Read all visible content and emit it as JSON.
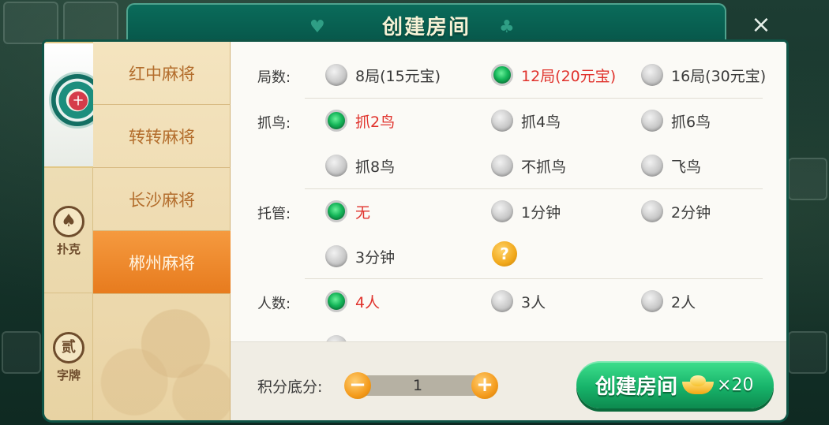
{
  "header": {
    "title": "创建房间",
    "close_icon": "×"
  },
  "categories": [
    {
      "name": "mahjong",
      "label": ""
    },
    {
      "name": "poker",
      "icon": "♠",
      "label": "扑克"
    },
    {
      "name": "word-tiles",
      "icon": "贰",
      "label": "字牌"
    }
  ],
  "mahjong_emblem_text": "十",
  "sub_tabs": [
    {
      "label": "红中麻将",
      "active": false
    },
    {
      "label": "转转麻将",
      "active": false
    },
    {
      "label": "长沙麻将",
      "active": false
    },
    {
      "label": "郴州麻将",
      "active": true
    }
  ],
  "rounds": {
    "label": "局数:",
    "options": [
      {
        "label": "8局(15元宝)",
        "selected": false
      },
      {
        "label": "12局(20元宝)",
        "selected": true
      },
      {
        "label": "16局(30元宝)",
        "selected": false
      }
    ]
  },
  "birds": {
    "label": "抓鸟:",
    "options": [
      {
        "label": "抓2鸟",
        "selected": true
      },
      {
        "label": "抓4鸟",
        "selected": false
      },
      {
        "label": "抓6鸟",
        "selected": false
      },
      {
        "label": "抓8鸟",
        "selected": false
      },
      {
        "label": "不抓鸟",
        "selected": false
      },
      {
        "label": "飞鸟",
        "selected": false
      }
    ]
  },
  "hosting": {
    "label": "托管:",
    "options": [
      {
        "label": "无",
        "selected": true
      },
      {
        "label": "1分钟",
        "selected": false
      },
      {
        "label": "2分钟",
        "selected": false
      },
      {
        "label": "3分钟",
        "selected": false
      }
    ],
    "help_icon": "?"
  },
  "players": {
    "label": "人数:",
    "options": [
      {
        "label": "4人",
        "selected": true
      },
      {
        "label": "3人",
        "selected": false
      },
      {
        "label": "2人",
        "selected": false
      }
    ]
  },
  "score": {
    "label": "积分底分:",
    "value": "1",
    "minus": "−",
    "plus": "+"
  },
  "create": {
    "label": "创建房间",
    "cost": "×20"
  },
  "colors": {
    "selected_text": "#e0322c",
    "active_tab": "#e77b1e",
    "create_button": "#17b36a"
  }
}
